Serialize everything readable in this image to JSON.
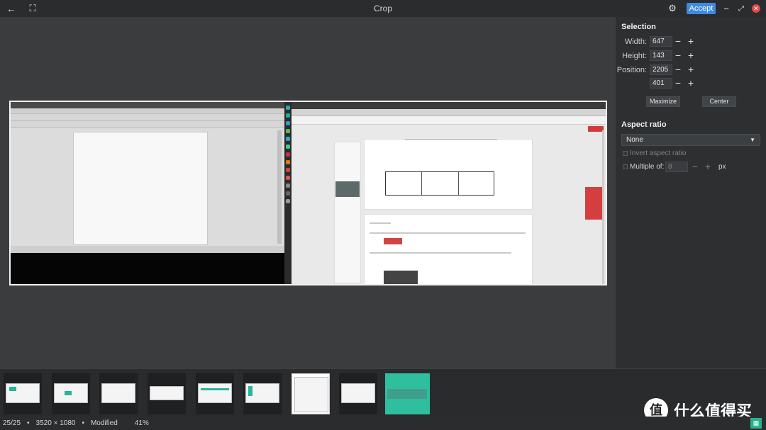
{
  "window": {
    "title": "Crop",
    "back_icon": "←",
    "fullscreen_icon": "⛶",
    "settings_icon": "⚙",
    "accept_label": "Accept",
    "minimize_icon": "−",
    "maximize_icon": "⤢",
    "close_icon": "✕"
  },
  "selection": {
    "heading": "Selection",
    "width_label": "Width:",
    "width_value": "647",
    "height_label": "Height:",
    "height_value": "143",
    "position_label": "Position:",
    "position_x": "2205",
    "position_y": "401",
    "decrement": "−",
    "increment": "+",
    "maximize_label": "Maximize",
    "center_label": "Center"
  },
  "aspect_ratio": {
    "heading": "Aspect ratio",
    "selected": "None",
    "caret": "▼",
    "invert_label": "Invert aspect ratio",
    "multiple_label": "Multiple of:",
    "multiple_value": "8",
    "unit": "px"
  },
  "filmstrip": {
    "count": 9,
    "active_index": 8
  },
  "status": {
    "index": "25/25",
    "dimensions": "3520 × 1080",
    "state": "Modified",
    "zoom": "41%",
    "sep": "•"
  },
  "watermark": {
    "logo_glyph": "值",
    "text": "什么值得买"
  },
  "colors": {
    "accent": "#3d8be0",
    "close": "#e04747",
    "teal": "#2fbf9e"
  }
}
